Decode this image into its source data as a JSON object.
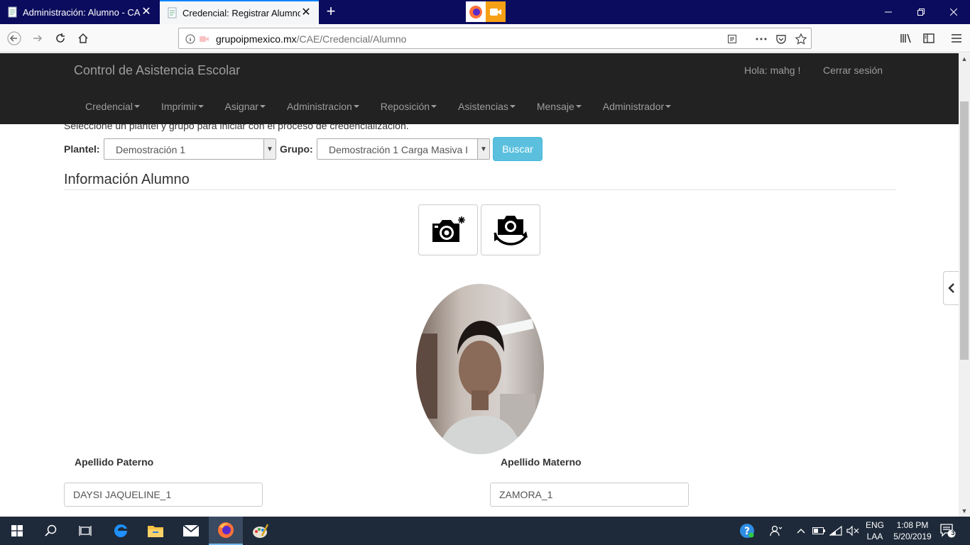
{
  "browser": {
    "tabs": [
      {
        "title": "Administración: Alumno - CAE",
        "active": false
      },
      {
        "title": "Credencial: Registrar Alumno",
        "active": true
      }
    ],
    "url_host": "grupoipmexico.mx",
    "url_path": "/CAE/Credencial/Alumno"
  },
  "app": {
    "brand": "Control de Asistencia Escolar",
    "greeting": "Hola: mahg !",
    "logout": "Cerrar sesión",
    "menu": [
      "Credencial",
      "Imprimir",
      "Asignar",
      "Administracion",
      "Reposición",
      "Asistencias",
      "Mensaje",
      "Administrador"
    ]
  },
  "form": {
    "instruction": "Seleccione un plantel y grupo para iniciar con el proceso de credencialización.",
    "plantel_label": "Plantel:",
    "plantel_value": "Demostración 1",
    "grupo_label": "Grupo:",
    "grupo_value": "Demostración 1 Carga Masiva I",
    "search_button": "Buscar",
    "section_title": "Información Alumno",
    "apellido_paterno_label": "Apellido Paterno",
    "apellido_paterno_value": "DAYSI JAQUELINE_1",
    "apellido_materno_label": "Apellido Materno",
    "apellido_materno_value": "ZAMORA_1"
  },
  "icons": {
    "take_photo": "camera-flash-icon",
    "switch_camera": "camera-switch-icon",
    "sidebar_toggle": "chevron-left-icon"
  },
  "taskbar": {
    "lang_top": "ENG",
    "lang_bottom": "LAA",
    "time": "1:08 PM",
    "date": "5/20/2019",
    "notifications": "3"
  },
  "colors": {
    "tabstrip": "#0c0c5e",
    "app_header": "#222222",
    "search_button": "#5bc0de",
    "taskbar": "#1e2a3a"
  }
}
